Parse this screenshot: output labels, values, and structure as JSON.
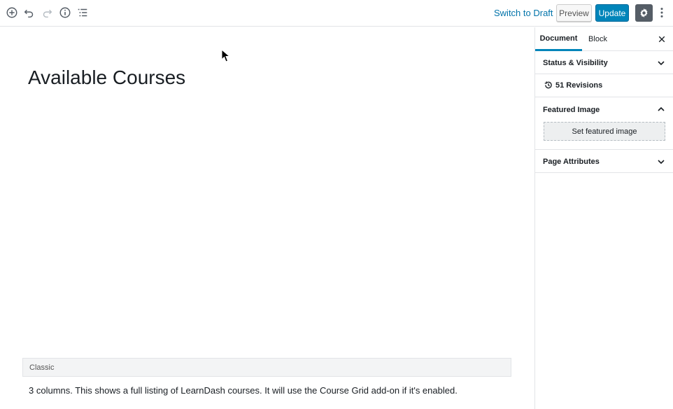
{
  "toolbar": {
    "switch_to_draft": "Switch to Draft",
    "preview": "Preview",
    "update": "Update"
  },
  "editor": {
    "title": "Available Courses",
    "classic_block_label": "Classic",
    "classic_block_text": "3 columns. This shows a full listing of LearnDash courses. It will use the Course Grid add-on if it's enabled."
  },
  "sidebar": {
    "tabs": [
      {
        "label": "Document",
        "active": true
      },
      {
        "label": "Block",
        "active": false
      }
    ],
    "status_visibility": "Status & Visibility",
    "revisions": "51 Revisions",
    "featured_image": "Featured Image",
    "set_featured_image": "Set featured image",
    "page_attributes": "Page Attributes"
  },
  "colors": {
    "accent": "#0085ba",
    "link": "#0073aa",
    "settings_bg": "#555d66"
  }
}
